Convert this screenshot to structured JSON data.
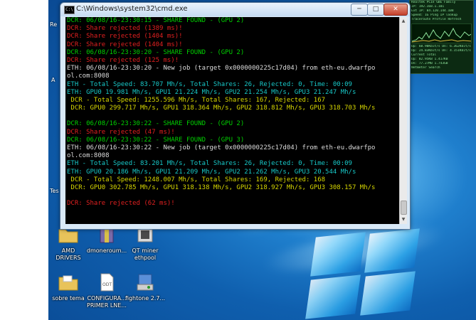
{
  "window": {
    "title": "C:\\Windows\\system32\\cmd.exe",
    "icon_text": "C:\\",
    "min_label": "─",
    "max_label": "□",
    "close_label": "✕"
  },
  "console_lines": [
    {
      "text": "DCR: 06/08/16-23:30:15 - SHARE FOUND - (GPU 2)",
      "color": "green"
    },
    {
      "text": "DCR: Share rejected (1389 ms)!",
      "color": "red"
    },
    {
      "text": "DCR: Share rejected (1404 ms)!",
      "color": "red"
    },
    {
      "text": "DCR: Share rejected (1404 ms)!",
      "color": "red"
    },
    {
      "text": "DCR: 06/08/16-23:30:20 - SHARE FOUND - (GPU 2)",
      "color": "green"
    },
    {
      "text": "DCR: Share rejected (125 ms)!",
      "color": "red"
    },
    {
      "text": "ETH: 06/08/16-23:30:20 - New job (target 0x0000000225c17d04) from eth-eu.dwarfpo",
      "color": "white"
    },
    {
      "text": "ol.com:8008",
      "color": "white"
    },
    {
      "text": "ETH - Total Speed: 83.707 Mh/s, Total Shares: 26, Rejected: 0, Time: 00:09",
      "color": "cyan"
    },
    {
      "text": "ETH: GPU0 19.981 Mh/s, GPU1 21.224 Mh/s, GPU2 21.254 Mh/s, GPU3 21.247 Mh/s",
      "color": "cyan"
    },
    {
      "text": " DCR - Total Speed: 1255.596 Mh/s, Total Shares: 167, Rejected: 167",
      "color": "yellow"
    },
    {
      "text": " DCR: GPU0 299.717 Mh/s, GPU1 318.364 Mh/s, GPU2 318.812 Mh/s, GPU3 318.703 Mh/s",
      "color": "yellow"
    },
    {
      "text": "",
      "color": "white"
    },
    {
      "text": "DCR: 06/08/16-23:30:22 - SHARE FOUND - (GPU 2)",
      "color": "green"
    },
    {
      "text": "DCR: Share rejected (47 ms)!",
      "color": "red"
    },
    {
      "text": "DCR: 06/08/16-23:30:22 - SHARE FOUND - (GPU 3)",
      "color": "green"
    },
    {
      "text": "ETH: 06/08/16-23:30:22 - New job (target 0x0000000225c17d04) from eth-eu.dwarfpo",
      "color": "white"
    },
    {
      "text": "ol.com:8008",
      "color": "white"
    },
    {
      "text": "ETH - Total Speed: 83.201 Mh/s, Total Shares: 26, Rejected: 0, Time: 00:09",
      "color": "cyan"
    },
    {
      "text": "ETH: GPU0 20.186 Mh/s, GPU1 21.209 Mh/s, GPU2 21.262 Mh/s, GPU3 20.544 Mh/s",
      "color": "cyan"
    },
    {
      "text": " DCR - Total Speed: 1248.007 Mh/s, Total Shares: 169, Rejected: 168",
      "color": "yellow"
    },
    {
      "text": " DCR: GPU0 302.785 Mh/s, GPU1 318.138 Mh/s, GPU2 318.927 Mh/s, GPU3 308.157 Mh/s",
      "color": "yellow"
    },
    {
      "text": "",
      "color": "white"
    },
    {
      "text": "DCR: Share rejected (62 ms)!",
      "color": "red"
    }
  ],
  "desktop_icons": [
    {
      "name": "desktop-icon-amd-drivers",
      "label": "AMD\nDRIVERS",
      "icon": "folder-icon"
    },
    {
      "name": "desktop-icon-dmonero",
      "label": "dmoneroum...",
      "icon": "archive-icon"
    },
    {
      "name": "desktop-icon-qt-miner",
      "label": "QT miner\nethpool",
      "icon": "app-icon"
    },
    {
      "name": "desktop-icon-sobre-tema",
      "label": "sobre tema",
      "icon": "folder-icon"
    },
    {
      "name": "desktop-icon-configura",
      "label": "CONFIGURA...\nPRIMER LNE...",
      "icon": "document-icon"
    },
    {
      "name": "desktop-icon-fightone",
      "label": "fightone 2.7...",
      "icon": "installer-icon"
    }
  ],
  "edge_labels": [
    {
      "name": "edge-label-re",
      "text": "Re"
    },
    {
      "name": "edge-label-a",
      "text": "A"
    },
    {
      "name": "edge-label-tes",
      "text": "Tes"
    }
  ],
  "gadget": {
    "lines_top": [
      "Realtek PCIe GBE Family",
      "IP: 192.168.1.101",
      "Ext IP: 84.120.144.108",
      "Speed: 1G  Ping  IP lookup",
      "Traceroute  Profile  Refresh"
    ],
    "speeds": [
      "Up: 60.90Kbit/s   Dn: 6.362Kbit/s",
      "Up: 24.83Kbit/s   Dn: 4.151Kbit/s"
    ],
    "lines_bottom": [
      "Current  Total",
      "Up: 82.95KB  1.417KB",
      "Dn: 77.27MB  1.743GB",
      "Netmeter  Search"
    ],
    "accent": "#8fe59c"
  },
  "colors": {
    "green": "#00d000",
    "red": "#e02020",
    "white": "#dcdcdc",
    "cyan": "#18c8c8",
    "yellow": "#d8d800"
  }
}
